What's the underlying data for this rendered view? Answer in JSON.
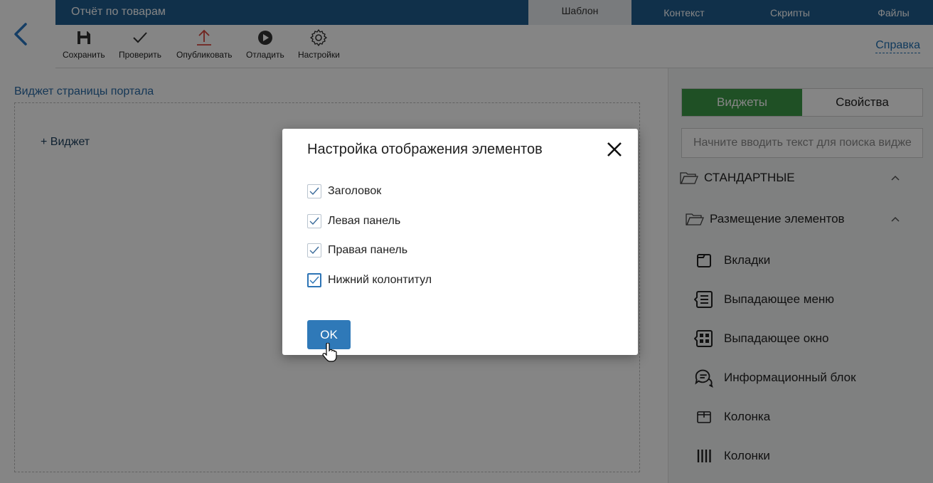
{
  "header": {
    "doc_title": "Отчёт по товарам",
    "tabs": [
      {
        "label": "Шаблон",
        "active": true
      },
      {
        "label": "Контекст"
      },
      {
        "label": "Скрипты"
      },
      {
        "label": "Файлы"
      }
    ]
  },
  "toolbar": {
    "save": "Сохранить",
    "check": "Проверить",
    "publish": "Опубликовать",
    "debug": "Отладить",
    "settings": "Настройки",
    "help": "Справка"
  },
  "main": {
    "section_title": "Виджет страницы портала",
    "add_widget": "+ Виджет"
  },
  "right_panel": {
    "tabs": [
      {
        "label": "Виджеты",
        "active": true
      },
      {
        "label": "Свойства"
      }
    ],
    "search_placeholder": "Начните вводить текст для поиска виджета",
    "group_standard": "СТАНДАРТНЫЕ",
    "group_layout": "Размещение элементов",
    "items": [
      {
        "label": "Вкладки",
        "icon": "tabs-icon"
      },
      {
        "label": "Выпадающее меню",
        "icon": "dropdown-menu-icon"
      },
      {
        "label": "Выпадающее окно",
        "icon": "dropdown-window-icon"
      },
      {
        "label": "Информационный блок",
        "icon": "info-block-icon"
      },
      {
        "label": "Колонка",
        "icon": "column-icon"
      },
      {
        "label": "Колонки",
        "icon": "columns-icon"
      }
    ]
  },
  "modal": {
    "title": "Настройка отображения элементов",
    "options": [
      {
        "label": "Заголовок",
        "checked": true
      },
      {
        "label": "Левая панель",
        "checked": true
      },
      {
        "label": "Правая панель",
        "checked": true
      },
      {
        "label": "Нижний колонтитул",
        "checked": true
      }
    ],
    "ok": "OK"
  },
  "colors": {
    "header_blue": "#1f5c8f",
    "accent_green": "#3c9a47",
    "button_blue": "#2f79b8",
    "publish_red": "#d9443c"
  }
}
